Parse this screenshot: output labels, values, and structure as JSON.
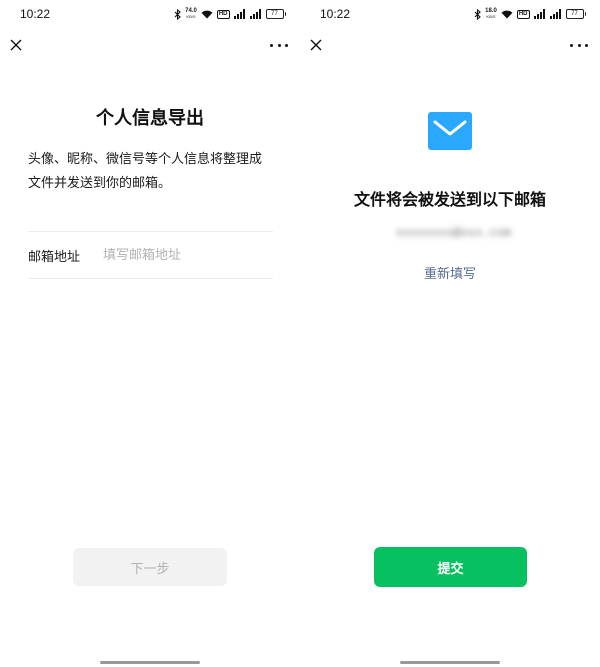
{
  "status_bar": {
    "time": "10:22",
    "left_speed": "74.0",
    "right_speed": "18.0",
    "speed_unit": "KB/S",
    "hd": "HD",
    "battery": "77"
  },
  "left_screen": {
    "title": "个人信息导出",
    "description": "头像、昵称、微信号等个人信息将整理成文件并发送到你的邮箱。",
    "email_label": "邮箱地址",
    "email_placeholder": "填写邮箱地址",
    "email_value": "",
    "next_button": "下一步"
  },
  "right_screen": {
    "title": "文件将会被发送到以下邮箱",
    "email_display": "xxxxxxxx@xxx.com",
    "refill_link": "重新填写",
    "submit_button": "提交"
  },
  "colors": {
    "accent_green": "#07c160",
    "link_blue": "#576b95",
    "mail_icon": "#2aa8ff",
    "disabled_bg": "#f2f2f2",
    "disabled_text": "#b2b2b2"
  },
  "icons": [
    "bluetooth-icon",
    "wifi-icon",
    "signal-icon",
    "battery-icon",
    "close-icon",
    "more-icon",
    "mail-icon"
  ]
}
